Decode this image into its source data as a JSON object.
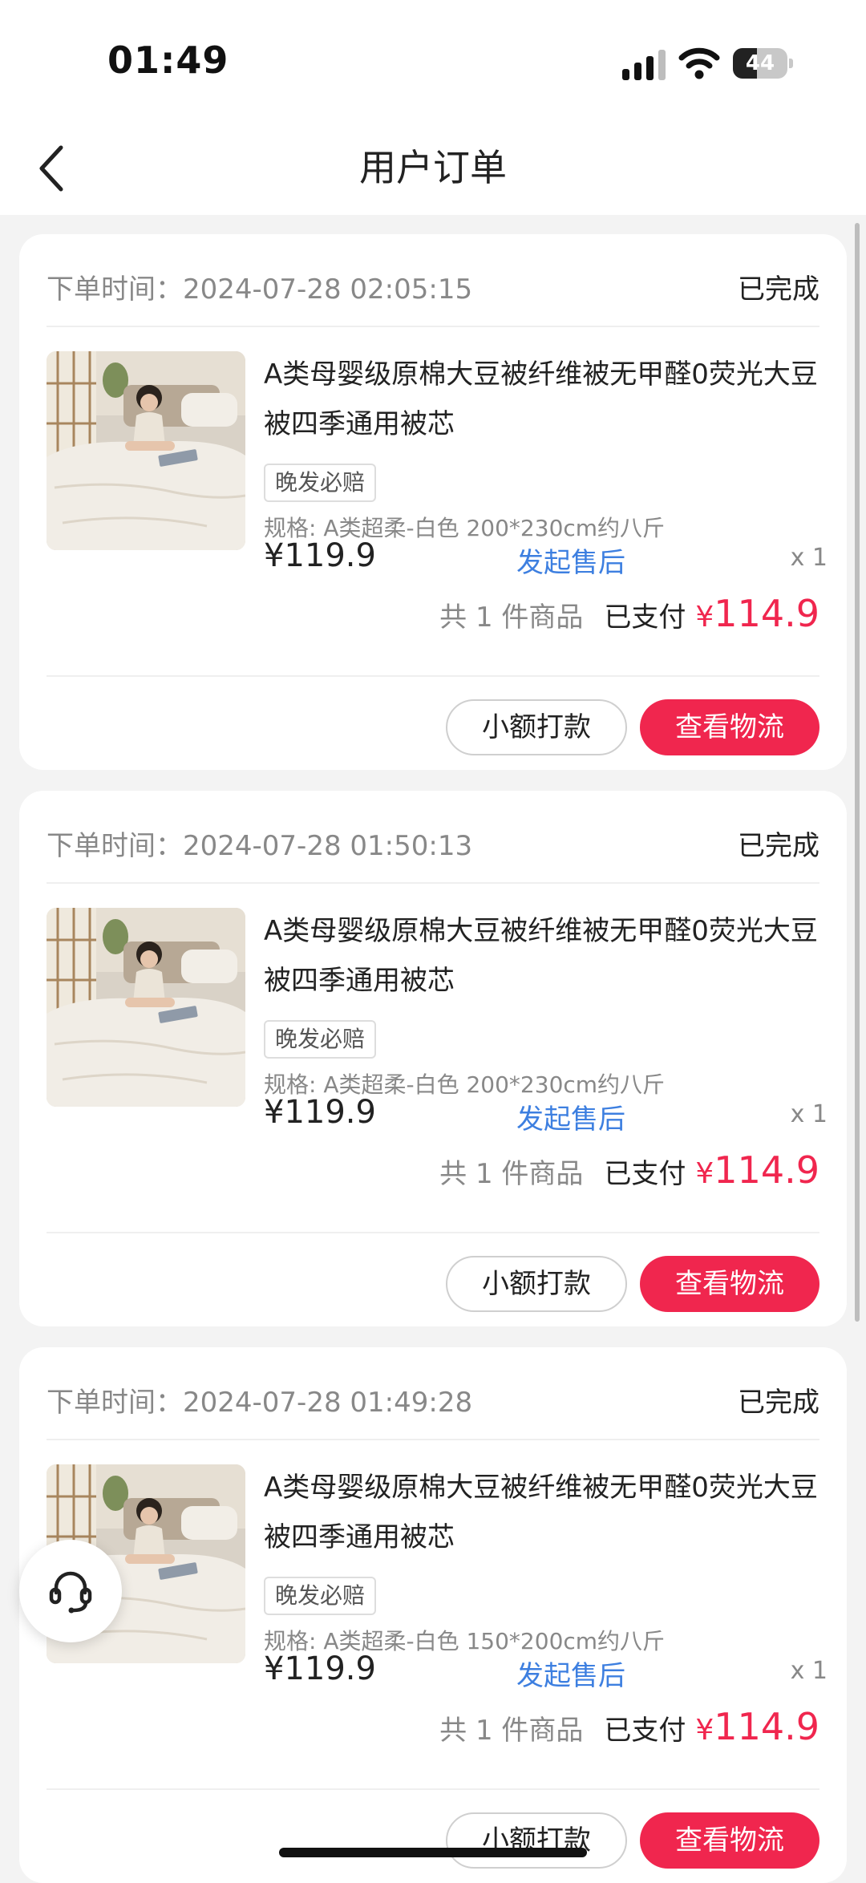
{
  "status_bar": {
    "time": "01:49",
    "battery": "44",
    "battery_level": 0.44
  },
  "nav": {
    "title": "用户订单"
  },
  "labels": {
    "order_time_prefix": "下单时间：",
    "count_text": "共 1 件商品",
    "paid_label": "已支付",
    "currency": "¥",
    "after_sale": "发起售后",
    "btn_transfer": "小额打款",
    "btn_logistics": "查看物流"
  },
  "orders": [
    {
      "time": "2024-07-28 02:05:15",
      "status": "已完成",
      "title": "A类母婴级原棉大豆被纤维被无甲醛0荧光大豆被四季通用被芯",
      "badge": "晚发必赔",
      "spec": "规格: A类超柔-白色 200*230cm约八斤",
      "price": "¥119.9",
      "qty": "x 1",
      "paid": "114.9"
    },
    {
      "time": "2024-07-28 01:50:13",
      "status": "已完成",
      "title": "A类母婴级原棉大豆被纤维被无甲醛0荧光大豆被四季通用被芯",
      "badge": "晚发必赔",
      "spec": "规格: A类超柔-白色 200*230cm约八斤",
      "price": "¥119.9",
      "qty": "x 1",
      "paid": "114.9"
    },
    {
      "time": "2024-07-28 01:49:28",
      "status": "已完成",
      "title": "A类母婴级原棉大豆被纤维被无甲醛0荧光大豆被四季通用被芯",
      "badge": "晚发必赔",
      "spec": "规格: A类超柔-白色 150*200cm约八斤",
      "price": "¥119.9",
      "qty": "x 1",
      "paid": "114.9"
    }
  ],
  "colors": {
    "accent": "#f0264e",
    "link": "#3d7fe0"
  }
}
